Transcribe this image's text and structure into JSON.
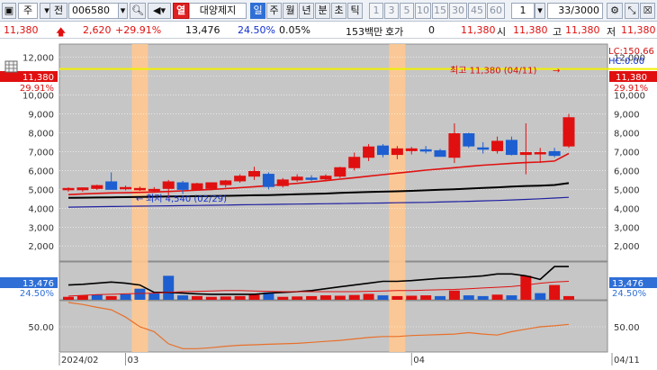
{
  "toolbar": {
    "market_type": "주",
    "prev_label": "전",
    "stock_code": "006580",
    "search_icon": "search-icon",
    "sound_icon": "speaker-icon",
    "warn_label": "열",
    "company_name": "대양제지",
    "periods": [
      "일",
      "주",
      "월",
      "년",
      "분",
      "초",
      "틱"
    ],
    "selected_period": "일",
    "intervals": [
      "1",
      "3",
      "5",
      "10",
      "15",
      "30",
      "45",
      "60"
    ],
    "interval_value": "1",
    "count_value": "33/3000"
  },
  "info": {
    "price": "11,380",
    "change": "2,620",
    "change_pct": "+29.91%",
    "volume": "13,476",
    "volume_ratio": "24.50%",
    "turnover": "0.05%",
    "amount": "153백만",
    "quote_label": "호가",
    "quote_value": "0",
    "quote_price": "11,380",
    "open_label": "시",
    "open_value": "11,380",
    "high_label": "고",
    "high_value": "11,380",
    "low_label": "저",
    "low_value": "11,380"
  },
  "chart_data": {
    "type": "candlestick",
    "price_axis": {
      "ticks": [
        "12,000",
        "11,000",
        "10,000",
        "9,000",
        "8,000",
        "7,000",
        "6,000",
        "5,000",
        "4,000",
        "3,000",
        "2,000"
      ],
      "tick_values": [
        12000,
        11000,
        10000,
        9000,
        8000,
        7000,
        6000,
        5000,
        4000,
        3000,
        2000
      ],
      "range": [
        1200,
        12700
      ]
    },
    "badges": {
      "last_price": "11,380",
      "last_pct": "29.91%",
      "lc": "LC:150.66",
      "hc": "HC:0.00"
    },
    "annotations": {
      "high_label": "최고 11,380 (04/11)",
      "low_label": "최저 4,540 (02/29)"
    },
    "candles": [
      {
        "o": 4980,
        "h": 5110,
        "l": 4880,
        "c": 5050
      },
      {
        "o": 4980,
        "h": 5100,
        "l": 4880,
        "c": 5080
      },
      {
        "o": 5050,
        "h": 5250,
        "l": 4970,
        "c": 5200
      },
      {
        "o": 5400,
        "h": 5900,
        "l": 5150,
        "c": 5000
      },
      {
        "o": 5050,
        "h": 5200,
        "l": 4950,
        "c": 5100
      },
      {
        "o": 5050,
        "h": 5150,
        "l": 4920,
        "c": 5050
      },
      {
        "o": 5000,
        "h": 5120,
        "l": 4900,
        "c": 5000
      },
      {
        "o": 5050,
        "h": 5500,
        "l": 4540,
        "c": 5400
      },
      {
        "o": 5350,
        "h": 5450,
        "l": 4750,
        "c": 5000
      },
      {
        "o": 5000,
        "h": 5350,
        "l": 4950,
        "c": 5300
      },
      {
        "o": 5050,
        "h": 5350,
        "l": 4950,
        "c": 5350
      },
      {
        "o": 5250,
        "h": 5500,
        "l": 5100,
        "c": 5450
      },
      {
        "o": 5450,
        "h": 5800,
        "l": 5350,
        "c": 5700
      },
      {
        "o": 5700,
        "h": 6200,
        "l": 5500,
        "c": 5950
      },
      {
        "o": 5800,
        "h": 5900,
        "l": 5000,
        "c": 5150
      },
      {
        "o": 5200,
        "h": 5600,
        "l": 5100,
        "c": 5500
      },
      {
        "o": 5500,
        "h": 5800,
        "l": 5400,
        "c": 5650
      },
      {
        "o": 5600,
        "h": 5750,
        "l": 5450,
        "c": 5550
      },
      {
        "o": 5550,
        "h": 5800,
        "l": 5450,
        "c": 5700
      },
      {
        "o": 5700,
        "h": 6200,
        "l": 5600,
        "c": 6150
      },
      {
        "o": 6150,
        "h": 6950,
        "l": 6000,
        "c": 6700
      },
      {
        "o": 6700,
        "h": 7400,
        "l": 6500,
        "c": 7250
      },
      {
        "o": 7300,
        "h": 7400,
        "l": 6700,
        "c": 6850
      },
      {
        "o": 6850,
        "h": 7300,
        "l": 6600,
        "c": 7150
      },
      {
        "o": 7050,
        "h": 7250,
        "l": 6850,
        "c": 7150
      },
      {
        "o": 7100,
        "h": 7300,
        "l": 6900,
        "c": 7050
      },
      {
        "o": 7050,
        "h": 7150,
        "l": 6750,
        "c": 6750
      },
      {
        "o": 6700,
        "h": 8500,
        "l": 6400,
        "c": 7950
      },
      {
        "o": 7950,
        "h": 8000,
        "l": 7200,
        "c": 7300
      },
      {
        "o": 7200,
        "h": 7500,
        "l": 6900,
        "c": 7150
      },
      {
        "o": 7050,
        "h": 7800,
        "l": 6900,
        "c": 7550
      },
      {
        "o": 7600,
        "h": 7800,
        "l": 6800,
        "c": 6850
      },
      {
        "o": 6850,
        "h": 8500,
        "l": 5800,
        "c": 6950
      },
      {
        "o": 6900,
        "h": 7200,
        "l": 6400,
        "c": 6950
      },
      {
        "o": 7000,
        "h": 7200,
        "l": 6700,
        "c": 6800
      },
      {
        "o": 7300,
        "h": 9000,
        "l": 7200,
        "c": 8800
      }
    ],
    "ma_red": [
      4720,
      4760,
      4790,
      4810,
      4820,
      4840,
      4860,
      4890,
      4920,
      4960,
      5000,
      5040,
      5090,
      5140,
      5200,
      5260,
      5320,
      5390,
      5460,
      5540,
      5620,
      5700,
      5780,
      5860,
      5940,
      6020,
      6080,
      6150,
      6220,
      6280,
      6330,
      6380,
      6420,
      6450,
      6500,
      6900
    ],
    "ma_black": [
      4550,
      4560,
      4570,
      4580,
      4590,
      4600,
      4610,
      4620,
      4630,
      4640,
      4650,
      4660,
      4670,
      4690,
      4700,
      4720,
      4740,
      4760,
      4780,
      4810,
      4840,
      4860,
      4880,
      4900,
      4920,
      4950,
      4980,
      5010,
      5040,
      5080,
      5110,
      5150,
      5180,
      5200,
      5230,
      5330
    ],
    "ma_blue": [
      4060,
      4070,
      4080,
      4090,
      4100,
      4110,
      4120,
      4130,
      4140,
      4150,
      4160,
      4170,
      4180,
      4190,
      4200,
      4210,
      4220,
      4230,
      4240,
      4250,
      4260,
      4270,
      4280,
      4290,
      4300,
      4310,
      4330,
      4350,
      4370,
      4390,
      4410,
      4440,
      4470,
      4500,
      4540,
      4580
    ],
    "highlight_indices": [
      5,
      23
    ],
    "volume": {
      "badge_value": "13,476",
      "badge_pct": "24.50%",
      "bars": [
        8,
        12,
        14,
        10,
        15,
        30,
        18,
        65,
        12,
        10,
        8,
        9,
        10,
        14,
        20,
        8,
        9,
        10,
        12,
        11,
        13,
        16,
        12,
        10,
        11,
        12,
        10,
        25,
        12,
        10,
        14,
        12,
        65,
        18,
        40,
        10
      ],
      "colors": [
        "r",
        "r",
        "b",
        "r",
        "b",
        "b",
        "b",
        "b",
        "b",
        "r",
        "r",
        "r",
        "r",
        "r",
        "b",
        "r",
        "r",
        "r",
        "r",
        "r",
        "r",
        "r",
        "b",
        "r",
        "r",
        "r",
        "b",
        "r",
        "b",
        "b",
        "r",
        "b",
        "r",
        "b",
        "r",
        "r"
      ],
      "line_black": [
        40,
        42,
        45,
        48,
        45,
        40,
        20,
        20,
        18,
        16,
        15,
        15,
        15,
        15,
        18,
        20,
        22,
        25,
        30,
        35,
        40,
        45,
        50,
        50,
        52,
        55,
        58,
        60,
        62,
        65,
        70,
        70,
        65,
        55,
        90,
        90
      ],
      "line_red": [
        10,
        12,
        14,
        15,
        16,
        17,
        18,
        20,
        22,
        23,
        24,
        25,
        25,
        24,
        23,
        22,
        22,
        22,
        22,
        22,
        22,
        23,
        24,
        25,
        25,
        26,
        27,
        28,
        30,
        32,
        34,
        36,
        40,
        45,
        48,
        50
      ]
    },
    "oscillator": {
      "tick": "50.00",
      "line": [
        100,
        96,
        90,
        85,
        70,
        50,
        40,
        15,
        5,
        5,
        7,
        10,
        12,
        13,
        14,
        15,
        16,
        18,
        20,
        22,
        25,
        28,
        30,
        30,
        32,
        33,
        34,
        35,
        38,
        35,
        33,
        40,
        45,
        50,
        52,
        55
      ]
    },
    "date_labels": [
      {
        "label": "2024/02",
        "index": 0
      },
      {
        "label": "03",
        "index": 4
      },
      {
        "label": "04",
        "index": 24
      },
      {
        "label": "04/11",
        "index": 35
      }
    ]
  }
}
